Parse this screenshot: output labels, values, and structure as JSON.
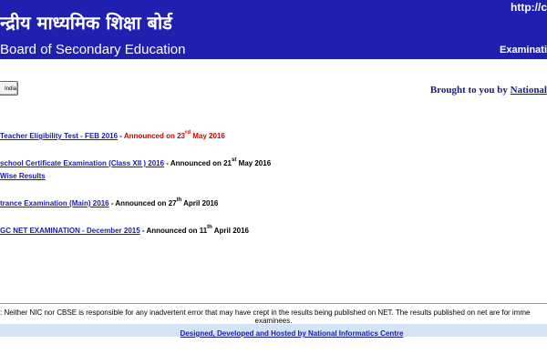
{
  "header": {
    "hindi_title": "न्द्रीय माध्यमिक शिक्षा बोर्ड",
    "url": "http://c",
    "board_name": "Board of Secondary Education",
    "exam_label": "Examinati"
  },
  "toolbar": {
    "india_button": "India",
    "brought_prefix": "Brought to you by ",
    "brought_link": "National"
  },
  "results": [
    {
      "link": "Teacher Eligibility Test - FEB 2016",
      "announced_prefix": "Announced on 23",
      "announced_sup": "rd",
      "announced_suffix": " May 2016",
      "highlight_color": "#cc0000"
    },
    {
      "link": "school Certificate Examination (Class XII ) 2016",
      "announced_prefix": "Announced on 21",
      "announced_sup": "st",
      "announced_suffix": " May 2016",
      "extra_link": "Wise Results"
    },
    {
      "link": "trance Examination (Main) 2016",
      "announced_prefix": "Announced on 27",
      "announced_sup": "th",
      "announced_suffix": " April 2016"
    },
    {
      "link": "GC NET EXAMINATION - December 2015",
      "announced_prefix": "Announced on 11",
      "announced_sup": "th",
      "announced_suffix": " April 2016"
    }
  ],
  "separator": " - ",
  "footer": {
    "disclaimer_line1": ": Neither NIC nor CBSE is responsible for any inadvertent error that may have crept in the results being published on NET. The results published on net are for imme",
    "disclaimer_line2": "examinees.",
    "credit_link": "Designed, Developed and Hosted by National Informatics Centre"
  },
  "colors": {
    "header_bg": "#1f1fb0",
    "link": "#1a1aa6",
    "announce_highlight": "#cc0000",
    "footer_bg": "#d4e4f4"
  }
}
